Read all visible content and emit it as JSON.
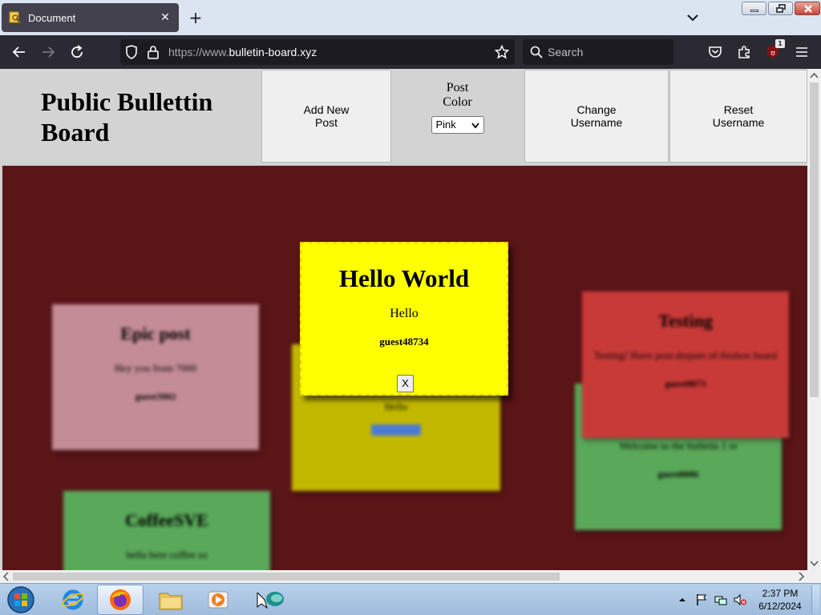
{
  "browser": {
    "tab_title": "Document",
    "url_prefix": "https://www.",
    "url_domain": "bulletin-board.xyz",
    "search_placeholder": "Search",
    "extension_badge": "1",
    "accent": "#42414d"
  },
  "header": {
    "site_title": "Public Bullettin Board",
    "add_post_label": "Add New Post",
    "post_color_label": "Post Color",
    "post_color_value": "Pink",
    "change_username_label": "Change Username",
    "reset_username_label": "Reset Username"
  },
  "board": {
    "background": "#5a1517",
    "posts": [
      {
        "title": "Epic post",
        "body": "Hey you from 7000",
        "user": "guest3902",
        "color": "#c48c96"
      },
      {
        "title": "",
        "body": "Hello",
        "user": "guest48734",
        "color": "#c2b800"
      },
      {
        "title": "",
        "body": "Welcome to the bulletin 1 re",
        "user": "guest8086",
        "color": "#5aa85a"
      },
      {
        "title": "Testing",
        "body": "Testing! Have post-dispute of thisbox board",
        "user": "guest8873",
        "color": "#c83a38"
      },
      {
        "title": "CoffeeSVE",
        "body": "bella here coffee so",
        "user": "",
        "color": "#5aa85a"
      }
    ]
  },
  "modal": {
    "title": "Hello World",
    "body": "Hello",
    "user": "guest48734",
    "close_label": "X",
    "color": "#ffff00"
  },
  "taskbar": {
    "time": "2:37 PM",
    "date": "6/12/2024"
  }
}
